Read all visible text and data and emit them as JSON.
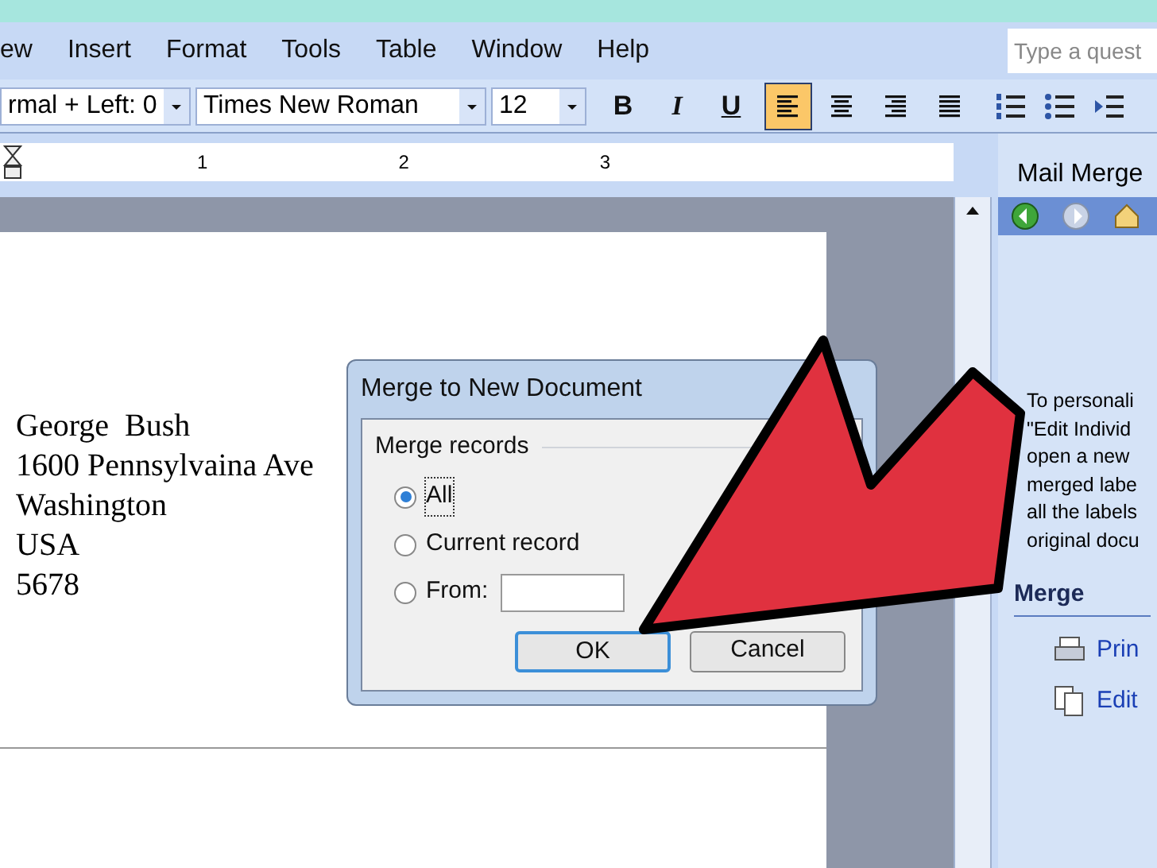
{
  "menu": [
    {
      "label": "ew"
    },
    {
      "label": "Insert"
    },
    {
      "label": "Format"
    },
    {
      "label": "Tools"
    },
    {
      "label": "Table"
    },
    {
      "label": "Window"
    },
    {
      "label": "Help"
    }
  ],
  "help_field": {
    "placeholder": "Type a quest"
  },
  "toolbar": {
    "style": "rmal + Left: 0",
    "font": "Times New Roman",
    "size": "12",
    "format_buttons": [
      {
        "label": "B",
        "kind": "bold"
      },
      {
        "label": "I",
        "kind": "italic"
      },
      {
        "label": "U",
        "kind": "underline"
      }
    ],
    "align_buttons": [
      {
        "kind": "left",
        "selected": true
      },
      {
        "kind": "center",
        "selected": false
      },
      {
        "kind": "right",
        "selected": false
      },
      {
        "kind": "justify",
        "selected": false
      }
    ]
  },
  "ruler": {
    "numbers": [
      "1",
      "2",
      "3"
    ]
  },
  "document": {
    "lines": [
      "George  Bush",
      "1600 Pennsylvaina Ave",
      "Washington",
      "USA",
      "5678"
    ]
  },
  "dialog": {
    "title": "Merge to New Document",
    "group": "Merge records",
    "options": [
      {
        "label": "All",
        "selected": true
      },
      {
        "label": "Current record",
        "selected": false
      },
      {
        "label": "From:",
        "selected": false
      }
    ],
    "buttons": [
      {
        "label": "OK",
        "default": true
      },
      {
        "label": "Cancel",
        "default": false
      }
    ]
  },
  "task_pane": {
    "title": "Mail Merge",
    "text_lines": [
      "To personali",
      "\"Edit Individ",
      "open a new",
      "merged labe",
      "all the labels",
      "original docu"
    ],
    "section": "Merge",
    "links": [
      {
        "label": "Prin",
        "kind": "print"
      },
      {
        "label": "Edit",
        "kind": "edit"
      }
    ]
  }
}
